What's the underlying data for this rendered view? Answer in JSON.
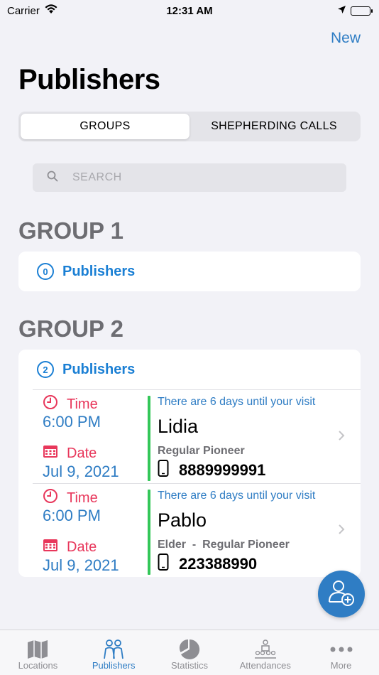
{
  "status_bar": {
    "carrier": "Carrier",
    "time": "12:31 AM"
  },
  "nav": {
    "new_label": "New"
  },
  "page_title": "Publishers",
  "segments": [
    {
      "label": "GROUPS",
      "active": true
    },
    {
      "label": "SHEPHERDING CALLS",
      "active": false
    }
  ],
  "search": {
    "placeholder": "SEARCH"
  },
  "groups": [
    {
      "title": "GROUP 1",
      "publisher_count": "0",
      "publishers_label": "Publishers",
      "publishers": []
    },
    {
      "title": "GROUP 2",
      "publisher_count": "2",
      "publishers_label": "Publishers",
      "publishers": [
        {
          "time_label": "Time",
          "time": "6:00 PM",
          "date_label": "Date",
          "date": "Jul 9, 2021",
          "visit_note": "There are 6 days until your visit",
          "name": "Lidia",
          "role": "Regular Pioneer",
          "phone": "8889999991"
        },
        {
          "time_label": "Time",
          "time": "6:00 PM",
          "date_label": "Date",
          "date": "Jul 9, 2021",
          "visit_note": "There are 6 days until your visit",
          "name": "Pablo",
          "role": "Elder  -  Regular Pioneer",
          "phone": "223388990"
        }
      ]
    }
  ],
  "tabs": [
    {
      "label": "Locations",
      "icon": "map-icon",
      "active": false
    },
    {
      "label": "Publishers",
      "icon": "people-icon",
      "active": true
    },
    {
      "label": "Statistics",
      "icon": "pie-chart-icon",
      "active": false
    },
    {
      "label": "Attendances",
      "icon": "audience-icon",
      "active": false
    },
    {
      "label": "More",
      "icon": "more-dots-icon",
      "active": false
    }
  ],
  "colors": {
    "accent": "#2f7dc4",
    "time_date_label": "#e8375b",
    "status_bar_line": "#34c759",
    "group_header": "#6d6d72",
    "background": "#f2f2f7"
  }
}
